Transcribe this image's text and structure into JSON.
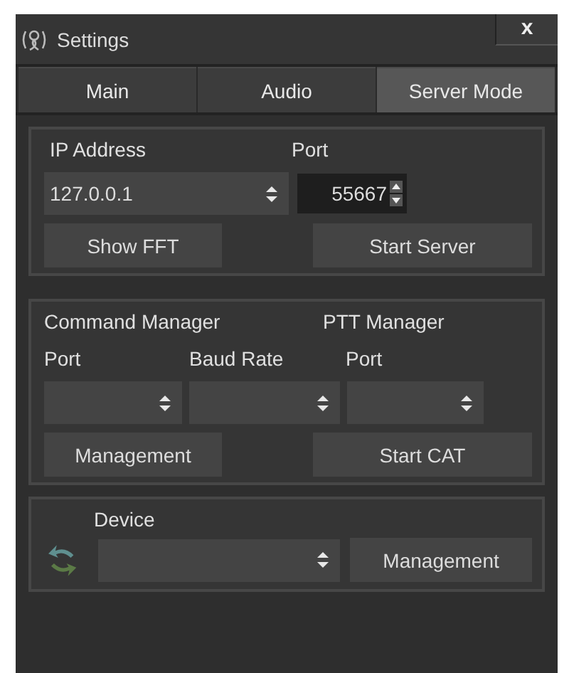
{
  "window": {
    "title": "Settings",
    "close": "x"
  },
  "tabs": [
    {
      "label": "Main",
      "selected": false
    },
    {
      "label": "Audio",
      "selected": false
    },
    {
      "label": "Server Mode",
      "selected": true
    }
  ],
  "server": {
    "ip_label": "IP Address",
    "ip_value": "127.0.0.1",
    "port_label": "Port",
    "port_value": "55667",
    "buttons": [
      "Show FFT",
      "Start Server"
    ]
  },
  "cat": {
    "command_manager": "Command Manager",
    "ptt_manager": "PTT Manager",
    "port_label": "Port",
    "baud_label": "Baud Rate",
    "ptt_port_label": "Port",
    "buttons": [
      "Management",
      "Start CAT"
    ]
  },
  "device": {
    "label": "Device",
    "button": "Management"
  }
}
